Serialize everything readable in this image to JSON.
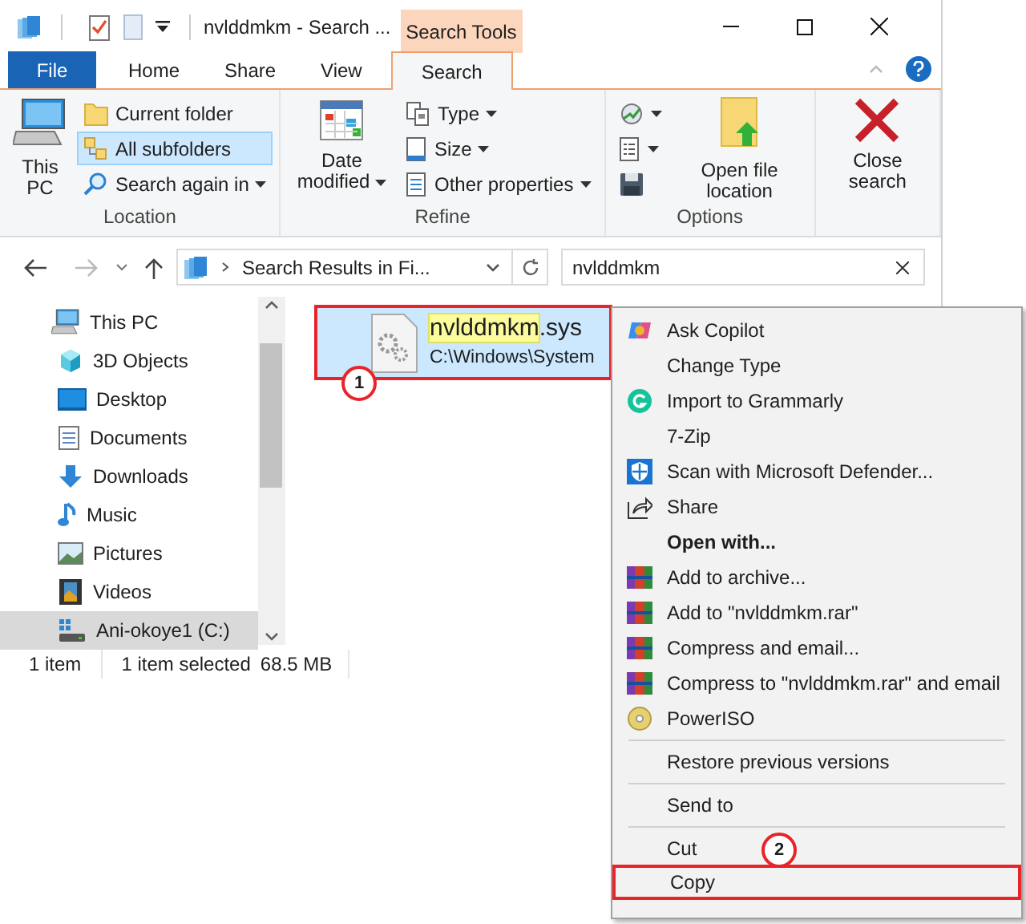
{
  "window": {
    "title": "nvlddmkm - Search ...",
    "context_tab": "Search Tools"
  },
  "quick_access": [
    {
      "kind": "check"
    },
    {
      "kind": "doc"
    },
    {
      "kind": "caret"
    }
  ],
  "ribbon_tabs": [
    {
      "label": "File",
      "kind": "file",
      "selected": false
    },
    {
      "label": "Home",
      "kind": "tab",
      "selected": false
    },
    {
      "label": "Share",
      "kind": "tab",
      "selected": false
    },
    {
      "label": "View",
      "kind": "tab",
      "selected": false
    },
    {
      "label": "Search",
      "kind": "tab",
      "selected": true
    }
  ],
  "ribbon_groups": [
    {
      "label": "Location",
      "items": [
        {
          "kind": "large",
          "label": "This PC",
          "dropdown": false
        },
        {
          "kind": "column",
          "buttons": [
            {
              "label": "Current folder",
              "dropdown": false,
              "selected": false
            },
            {
              "label": "All subfolders",
              "dropdown": false,
              "selected": true
            },
            {
              "label": "Search again in",
              "dropdown": true,
              "selected": false
            }
          ]
        }
      ]
    },
    {
      "label": "Refine",
      "items": [
        {
          "kind": "large",
          "label": "Date modified",
          "dropdown": true
        },
        {
          "kind": "column",
          "buttons": [
            {
              "label": "Type",
              "dropdown": true,
              "selected": false
            },
            {
              "label": "Size",
              "dropdown": true,
              "selected": false
            },
            {
              "label": "Other properties",
              "dropdown": true,
              "selected": false
            }
          ]
        }
      ]
    },
    {
      "label": "Options",
      "items": [
        {
          "kind": "column",
          "buttons": [
            {
              "dropdown": true,
              "selected": false
            },
            {
              "dropdown": true,
              "selected": false
            },
            {
              "dropdown": false,
              "selected": false
            }
          ]
        },
        {
          "kind": "large",
          "label": "Open file location",
          "dropdown": false
        }
      ]
    },
    {
      "items": [
        {
          "kind": "large",
          "label": "Close search",
          "dropdown": false
        }
      ]
    }
  ],
  "address": {
    "breadcrumb": "Search Results in Fi...",
    "search_value": "nvlddmkm"
  },
  "nav_tree": [
    {
      "label": "This PC",
      "kind": "pc",
      "selected": false,
      "children": [
        {
          "label": "3D Objects",
          "kind": "cube",
          "selected": false
        },
        {
          "label": "Desktop",
          "kind": "desktop",
          "selected": false
        },
        {
          "label": "Documents",
          "kind": "documents",
          "selected": false
        },
        {
          "label": "Downloads",
          "kind": "downloads",
          "selected": false
        },
        {
          "label": "Music",
          "kind": "music",
          "selected": false
        },
        {
          "label": "Pictures",
          "kind": "pictures",
          "selected": false
        },
        {
          "label": "Videos",
          "kind": "videos",
          "selected": false
        },
        {
          "label": "Ani-okoye1 (C:)",
          "kind": "drive",
          "selected": true
        }
      ]
    }
  ],
  "files": [
    {
      "name_match": "nvlddmkm",
      "name_rest": ".sys",
      "path": "C:\\Windows\\System",
      "selected": true,
      "annotation": "1"
    }
  ],
  "status_bar": {
    "count": "1 item",
    "selection": "1 item selected",
    "size": "68.5 MB"
  },
  "context_menu": [
    [
      {
        "label": "Ask Copilot",
        "kind": "copilot",
        "bold": false
      },
      {
        "label": "Change Type",
        "kind": "none",
        "bold": false
      },
      {
        "label": "Import to Grammarly",
        "kind": "grammarly",
        "bold": false
      },
      {
        "label": "7-Zip",
        "kind": "none",
        "bold": false
      },
      {
        "label": "Scan with Microsoft Defender...",
        "kind": "shield",
        "bold": false
      },
      {
        "label": "Share",
        "kind": "share",
        "bold": false
      },
      {
        "label": "Open with...",
        "kind": "none",
        "bold": true
      },
      {
        "label": "Add to archive...",
        "kind": "rar",
        "bold": false
      },
      {
        "label": "Add to \"nvlddmkm.rar\"",
        "kind": "rar",
        "bold": false
      },
      {
        "label": "Compress and email...",
        "kind": "rar",
        "bold": false
      },
      {
        "label": "Compress to \"nvlddmkm.rar\" and email",
        "kind": "rar",
        "bold": false
      },
      {
        "label": "PowerISO",
        "kind": "disc",
        "bold": false
      }
    ],
    [
      {
        "label": "Restore previous versions",
        "kind": "none",
        "bold": false
      }
    ],
    [
      {
        "label": "Send to",
        "kind": "none",
        "bold": false
      }
    ],
    [
      {
        "label": "Cut",
        "kind": "none",
        "bold": false
      },
      {
        "label": "Copy",
        "kind": "none",
        "bold": false,
        "annotation": "2"
      }
    ]
  ]
}
